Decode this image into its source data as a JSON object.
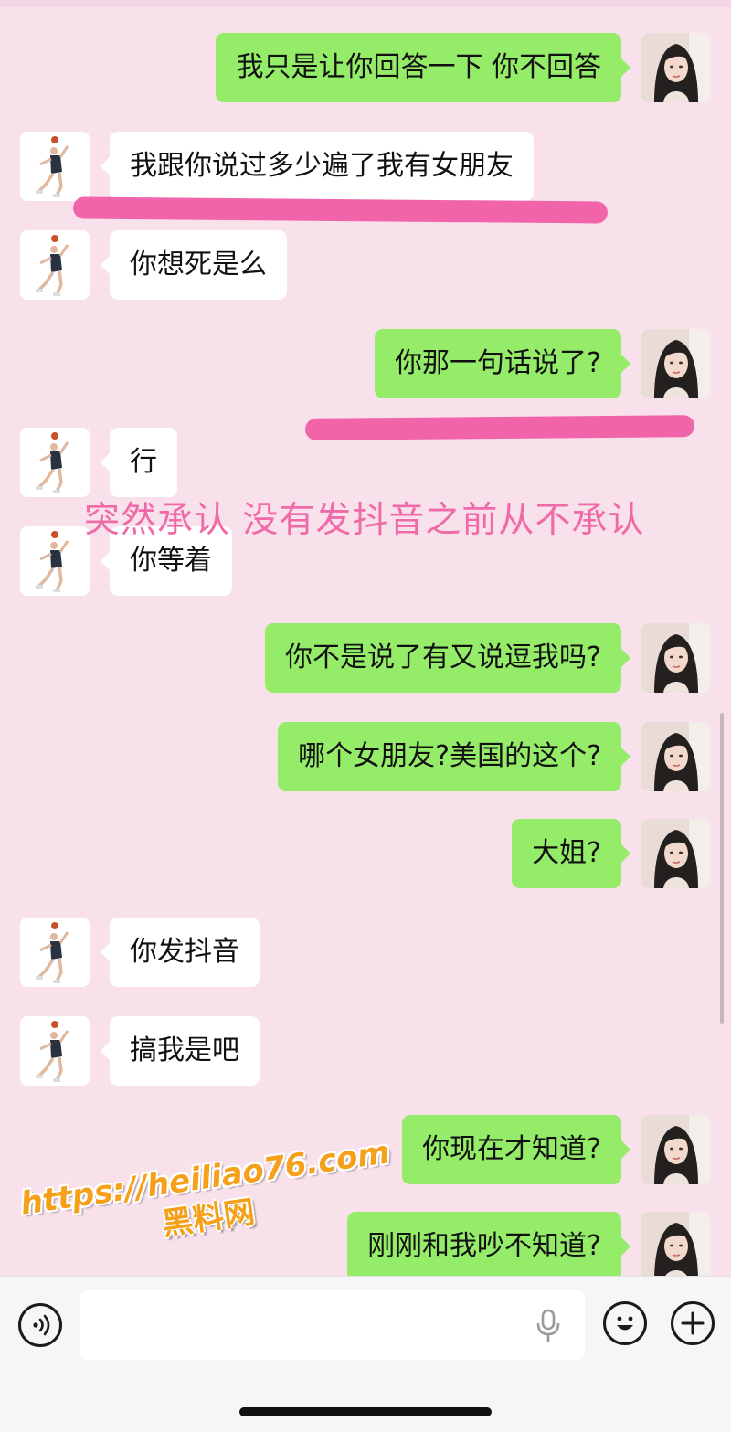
{
  "chat": {
    "messages": [
      {
        "side": "right",
        "text": "我只是让你回答一下 你不回答"
      },
      {
        "side": "left",
        "text": "我跟你说过多少遍了我有女朋友"
      },
      {
        "side": "left",
        "text": "你想死是么"
      },
      {
        "side": "right",
        "text": "你那一句话说了?"
      },
      {
        "side": "left",
        "text": "行"
      },
      {
        "side": "left",
        "text": "你等着"
      },
      {
        "side": "right",
        "text": "你不是说了有又说逗我吗?"
      },
      {
        "side": "right",
        "text": "哪个女朋友?美国的这个?"
      },
      {
        "side": "right",
        "text": "大姐?"
      },
      {
        "side": "left",
        "text": "你发抖音"
      },
      {
        "side": "left",
        "text": "搞我是吧"
      },
      {
        "side": "right",
        "text": "你现在才知道?"
      },
      {
        "side": "right",
        "text": "刚刚和我吵不知道?"
      }
    ]
  },
  "annotation": {
    "text": "突然承认 没有发抖音之前从不承认",
    "color": "#f06aa7",
    "highlight_color": "#f0529f"
  },
  "watermark": {
    "url": "https://heiliao76.com",
    "name": "黑料网",
    "color": "#f6a019"
  },
  "input_bar": {
    "value": "",
    "voice_icon": "voice-icon",
    "mic_icon": "mic-icon",
    "emoji_icon": "emoji-icon",
    "plus_icon": "plus-icon"
  },
  "colors": {
    "background": "#f9e1ec",
    "sent_bubble": "#95ec69",
    "received_bubble": "#ffffff"
  }
}
